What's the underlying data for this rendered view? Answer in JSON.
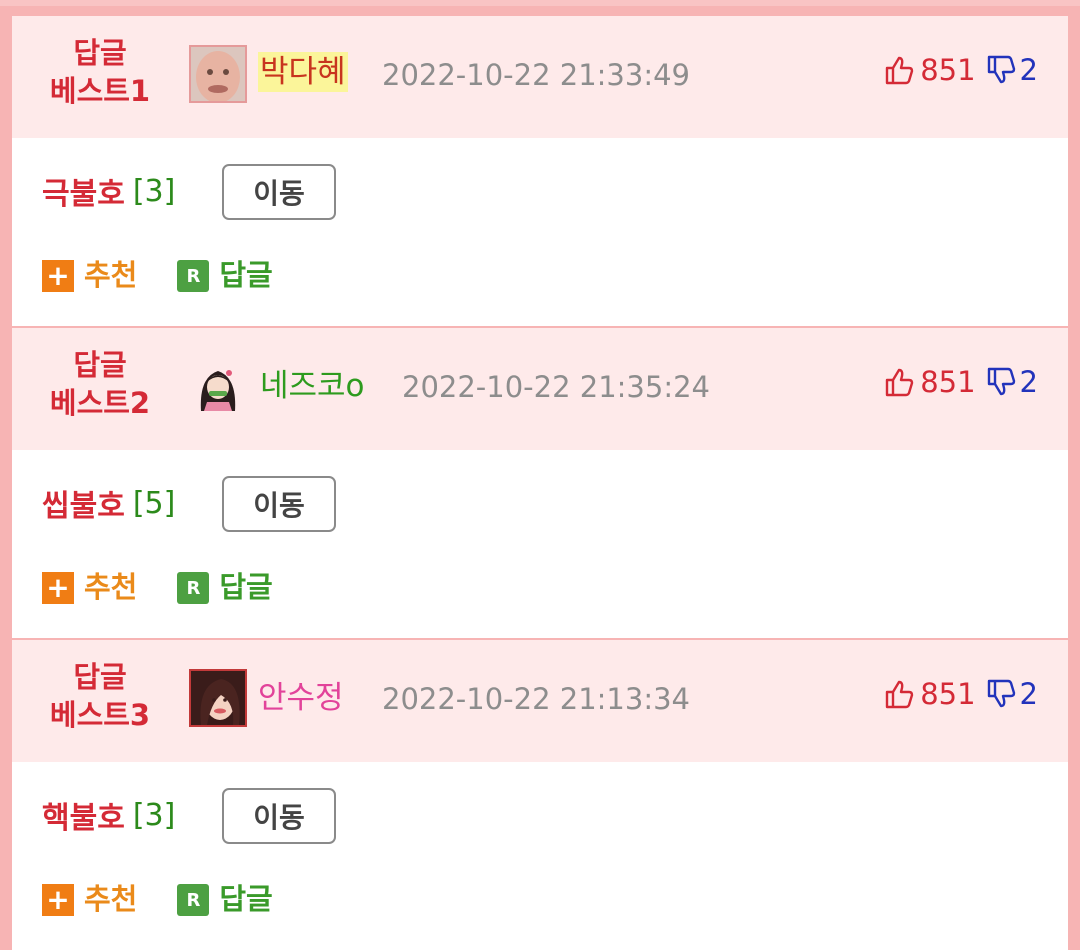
{
  "colors": {
    "accent_red": "#d42a36",
    "frame_pink": "#f7b4b4",
    "header_bg": "#feeaea"
  },
  "comments": [
    {
      "best_line1": "답글",
      "best_line2": "베스트1",
      "nickname": "박다혜",
      "nickname_color": "#c8341e",
      "nickname_highlight": "#fbf59a",
      "date": "2022-10-22 21:33:49",
      "up_count": "851",
      "down_count": "2",
      "title": "극불호",
      "reply_count": "[3]",
      "move_label": "이동",
      "recommend_label": "추천",
      "reply_label": "답글",
      "avatar_icon": "face-avatar-icon"
    },
    {
      "best_line1": "답글",
      "best_line2": "베스트2",
      "nickname": "네즈코o",
      "nickname_color": "#2e9b1e",
      "nickname_highlight": "",
      "date": "2022-10-22 21:35:24",
      "up_count": "851",
      "down_count": "2",
      "title": "씹불호",
      "reply_count": "[5]",
      "move_label": "이동",
      "recommend_label": "추천",
      "reply_label": "답글",
      "avatar_icon": "anime-girl-icon"
    },
    {
      "best_line1": "답글",
      "best_line2": "베스트3",
      "nickname": "안수정",
      "nickname_color": "#e2439a",
      "nickname_highlight": "",
      "date": "2022-10-22 21:13:34",
      "up_count": "851",
      "down_count": "2",
      "title": "핵불호",
      "reply_count": "[3]",
      "move_label": "이동",
      "recommend_label": "추천",
      "reply_label": "답글",
      "avatar_icon": "woman-photo-icon"
    }
  ]
}
